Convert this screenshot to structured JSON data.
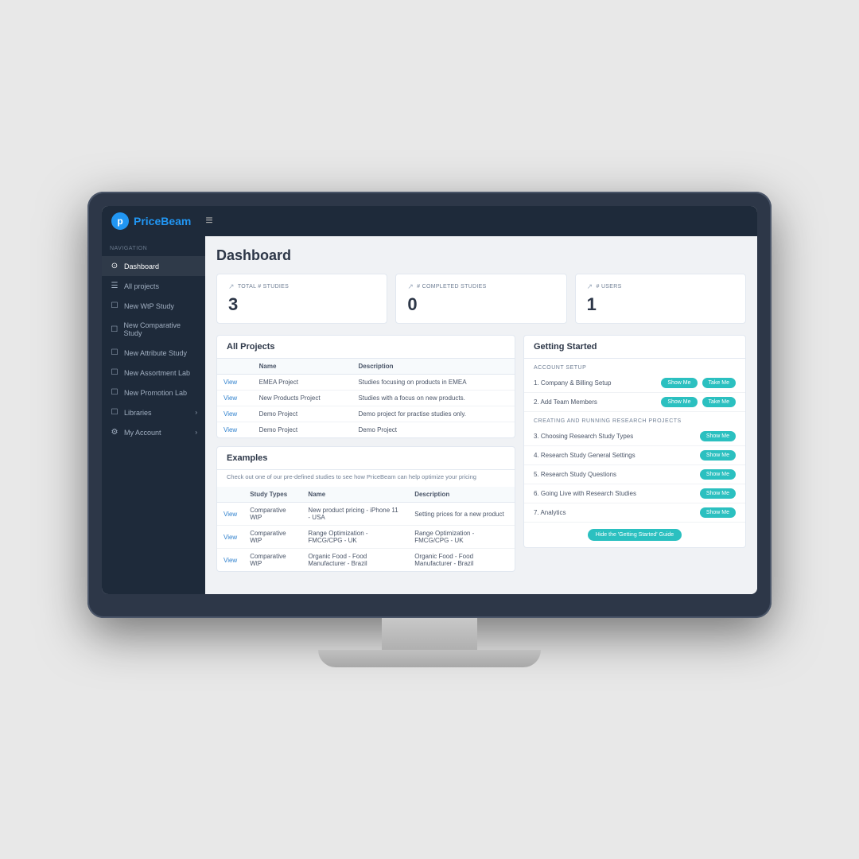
{
  "app": {
    "logo_p": "p",
    "logo_price": "Price",
    "logo_beam": "Beam"
  },
  "topbar": {
    "hamburger": "≡"
  },
  "sidebar": {
    "section_label": "NAVIGATION",
    "items": [
      {
        "id": "dashboard",
        "label": "Dashboard",
        "icon": "⊙",
        "active": true
      },
      {
        "id": "all-projects",
        "label": "All projects",
        "icon": "☰",
        "active": false
      },
      {
        "id": "new-wtp",
        "label": "New WtP Study",
        "icon": "☐",
        "active": false
      },
      {
        "id": "new-comparative",
        "label": "New Comparative Study",
        "icon": "☐",
        "active": false
      },
      {
        "id": "new-attribute",
        "label": "New Attribute Study",
        "icon": "☐",
        "active": false
      },
      {
        "id": "new-assortment",
        "label": "New Assortment Lab",
        "icon": "☐",
        "active": false
      },
      {
        "id": "new-promotion",
        "label": "New Promotion Lab",
        "icon": "☐",
        "active": false
      },
      {
        "id": "libraries",
        "label": "Libraries",
        "icon": "☐",
        "active": false,
        "has_arrow": true
      },
      {
        "id": "my-account",
        "label": "My Account",
        "icon": "⚙",
        "active": false,
        "has_arrow": true
      }
    ]
  },
  "page": {
    "title": "Dashboard"
  },
  "stats": [
    {
      "icon": "↗",
      "label": "TOTAL # STUDIES",
      "value": "3"
    },
    {
      "icon": "↗",
      "label": "# COMPLETED STUDIES",
      "value": "0"
    },
    {
      "icon": "↗",
      "label": "# USERS",
      "value": "1"
    }
  ],
  "all_projects": {
    "title": "All Projects",
    "columns": [
      "",
      "Name",
      "Description"
    ],
    "rows": [
      {
        "link": "View",
        "name": "EMEA Project",
        "description": "Studies focusing on products in EMEA"
      },
      {
        "link": "View",
        "name": "New Products Project",
        "description": "Studies with a focus on new products."
      },
      {
        "link": "View",
        "name": "Demo Project",
        "description": "Demo project for practise studies only."
      },
      {
        "link": "View",
        "name": "Demo Project",
        "description": "Demo Project"
      }
    ]
  },
  "examples": {
    "title": "Examples",
    "description": "Check out one of our pre-defined studies to see how PriceBeam can help optimize your pricing",
    "columns": [
      "",
      "Study Types",
      "Name",
      "Description"
    ],
    "rows": [
      {
        "link": "View",
        "type": "Comparative WtP",
        "name": "New product pricing - iPhone 11 - USA",
        "description": "Setting prices for a new product"
      },
      {
        "link": "View",
        "type": "Comparative WtP",
        "name": "Range Optimization - FMCG/CPG - UK",
        "description": "Range Optimization - FMCG/CPG - UK"
      },
      {
        "link": "View",
        "type": "Comparative WtP",
        "name": "Organic Food - Food Manufacturer - Brazil",
        "description": "Organic Food - Food Manufacturer - Brazil"
      }
    ]
  },
  "getting_started": {
    "title": "Getting Started",
    "account_setup_label": "ACCOUNT SETUP",
    "research_label": "CREATING AND RUNNING RESEARCH PROJECTS",
    "items": [
      {
        "id": "company-billing",
        "number": "1.",
        "label": "Company & Billing Setup",
        "show_me": "Show Me",
        "take_me": "Take Me"
      },
      {
        "id": "add-team",
        "number": "2.",
        "label": "Add Team Members",
        "show_me": "Show Me",
        "take_me": "Take Me"
      },
      {
        "id": "research-types",
        "number": "3.",
        "label": "Choosing Research Study Types",
        "show_me": "Show Me"
      },
      {
        "id": "general-settings",
        "number": "4.",
        "label": "Research Study General Settings",
        "show_me": "Show Me"
      },
      {
        "id": "questions",
        "number": "5.",
        "label": "Research Study Questions",
        "show_me": "Show Me"
      },
      {
        "id": "going-live",
        "number": "6.",
        "label": "Going Live with Research Studies",
        "show_me": "Show Me"
      },
      {
        "id": "analytics",
        "number": "7.",
        "label": "Analytics",
        "show_me": "Show Me"
      }
    ],
    "hide_guide_btn": "Hide the 'Getting Started' Guide"
  }
}
